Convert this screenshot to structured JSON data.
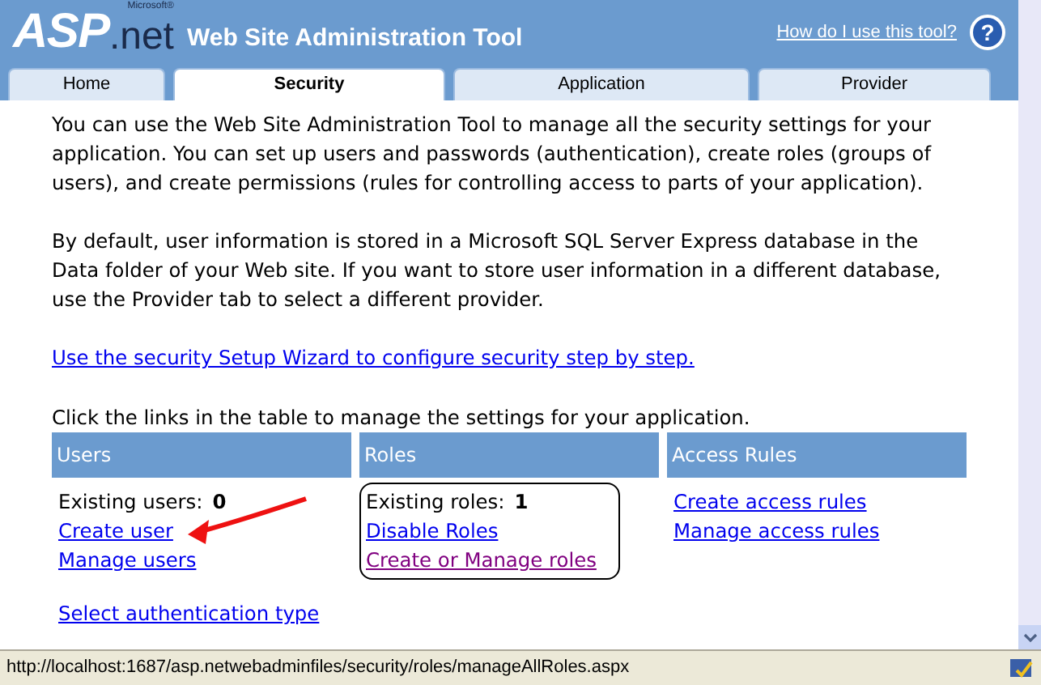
{
  "header": {
    "logo_main": "ASP",
    "logo_suffix": ".net",
    "logo_maker": "Microsoft®",
    "title": "Web Site Administration Tool",
    "help_link": "How do I use this tool?",
    "help_button": "?"
  },
  "tabs": [
    {
      "label": "Home",
      "selected": false
    },
    {
      "label": "Security",
      "selected": true
    },
    {
      "label": "Application",
      "selected": false
    },
    {
      "label": "Provider",
      "selected": false
    }
  ],
  "intro": [
    "You can use the Web Site Administration Tool to manage all the security settings for your application. You can set up users and passwords (authentication), create roles (groups of users), and create permissions (rules for controlling access to parts of your application).",
    "By default, user information is stored in a Microsoft SQL Server Express database in the Data folder of your Web site. If you want to store user information in a different database, use the Provider tab to select a different provider."
  ],
  "wizard_link": "Use the security Setup Wizard to configure security step by step.",
  "table_caption": "Click the links in the table to manage the settings for your application.",
  "columns": [
    {
      "heading": "Users",
      "count_label": "Existing users:",
      "count": "0",
      "links": [
        {
          "text": "Create user",
          "visited": false
        },
        {
          "text": "Manage users",
          "visited": false
        }
      ],
      "highlighted": false
    },
    {
      "heading": "Roles",
      "count_label": "Existing roles:",
      "count": "1",
      "links": [
        {
          "text": "Disable Roles",
          "visited": false
        },
        {
          "text": "Create or Manage roles",
          "visited": true
        }
      ],
      "highlighted": true
    },
    {
      "heading": "Access Rules",
      "links": [
        {
          "text": "Create access rules",
          "visited": false
        },
        {
          "text": "Manage access rules",
          "visited": false
        }
      ],
      "highlighted": false
    }
  ],
  "auth_link": "Select authentication type",
  "status_bar": {
    "url": "http://localhost:1687/asp.netwebadminfiles/security/roles/manageAllRoles.aspx"
  }
}
